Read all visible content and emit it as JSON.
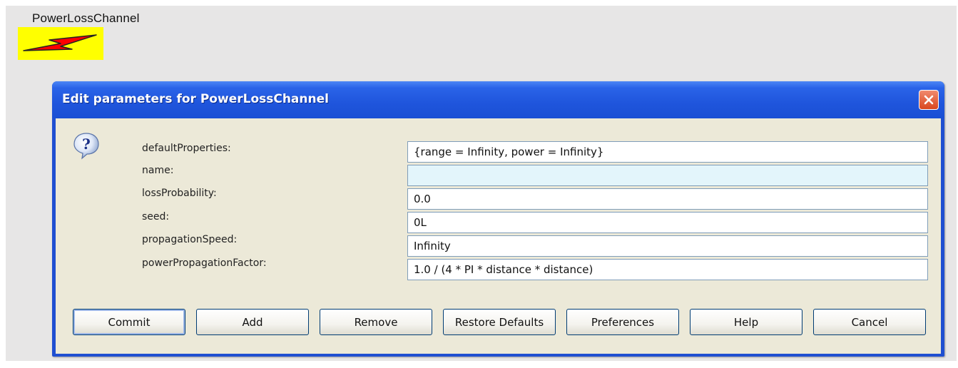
{
  "actor": {
    "label": "PowerLossChannel",
    "icon": "lightning-bolt-icon",
    "icon_background": "#ffff00",
    "bolt_color": "#ff0000"
  },
  "dialog": {
    "title": "Edit parameters for PowerLossChannel",
    "titlebar_color": "#1f55dc",
    "close_icon": "close-icon",
    "help_icon": "question-mark-icon",
    "parameters": [
      {
        "label": "defaultProperties:",
        "value": "{range = Infinity, power = Infinity}"
      },
      {
        "label": "name:",
        "value": ""
      },
      {
        "label": "lossProbability:",
        "value": "0.0"
      },
      {
        "label": "seed:",
        "value": "0L"
      },
      {
        "label": "propagationSpeed:",
        "value": "Infinity"
      },
      {
        "label": "powerPropagationFactor:",
        "value": "1.0 / (4 * PI * distance * distance)"
      }
    ],
    "buttons": {
      "commit": "Commit",
      "add": "Add",
      "remove": "Remove",
      "restore_defaults": "Restore Defaults",
      "preferences": "Preferences",
      "help": "Help",
      "cancel": "Cancel"
    }
  }
}
